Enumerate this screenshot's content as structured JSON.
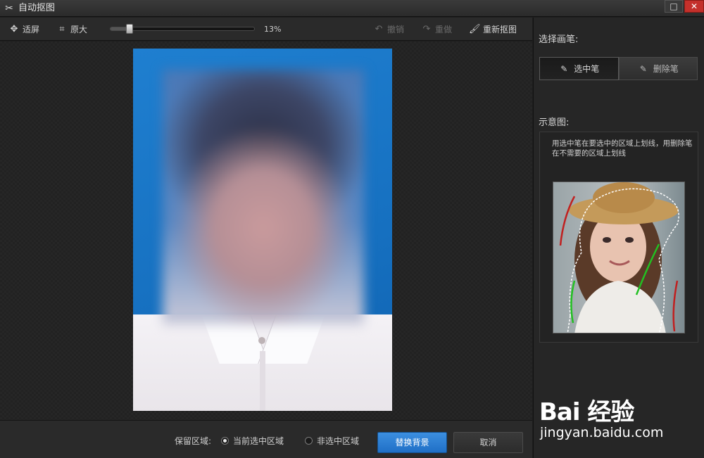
{
  "window": {
    "title": "自动抠图"
  },
  "toolbar": {
    "fit_label": "适屏",
    "original_label": "原大",
    "zoom_percent": 13,
    "zoom_text": "13%",
    "undo_label": "撤销",
    "redo_label": "重做",
    "redo_cutout_label": "重新抠图"
  },
  "bottom": {
    "keep_label": "保留区域:",
    "radio_current": "当前选中区域",
    "radio_non": "非选中区域",
    "replace_bg": "替换背景",
    "cancel": "取消"
  },
  "panel": {
    "brush_heading": "选择画笔:",
    "select_brush": "选中笔",
    "delete_brush": "删除笔",
    "diagram_heading": "示意图:",
    "hint": "用选中笔在要选中的区域上划线，用删除笔在不需要的区域上划线"
  },
  "watermark": {
    "logo": "Bai 经验",
    "url": "jingyan.baidu.com"
  },
  "colors": {
    "primary": "#1f6fc6",
    "close": "#c4302b",
    "photo_bg": "#1670c0"
  }
}
